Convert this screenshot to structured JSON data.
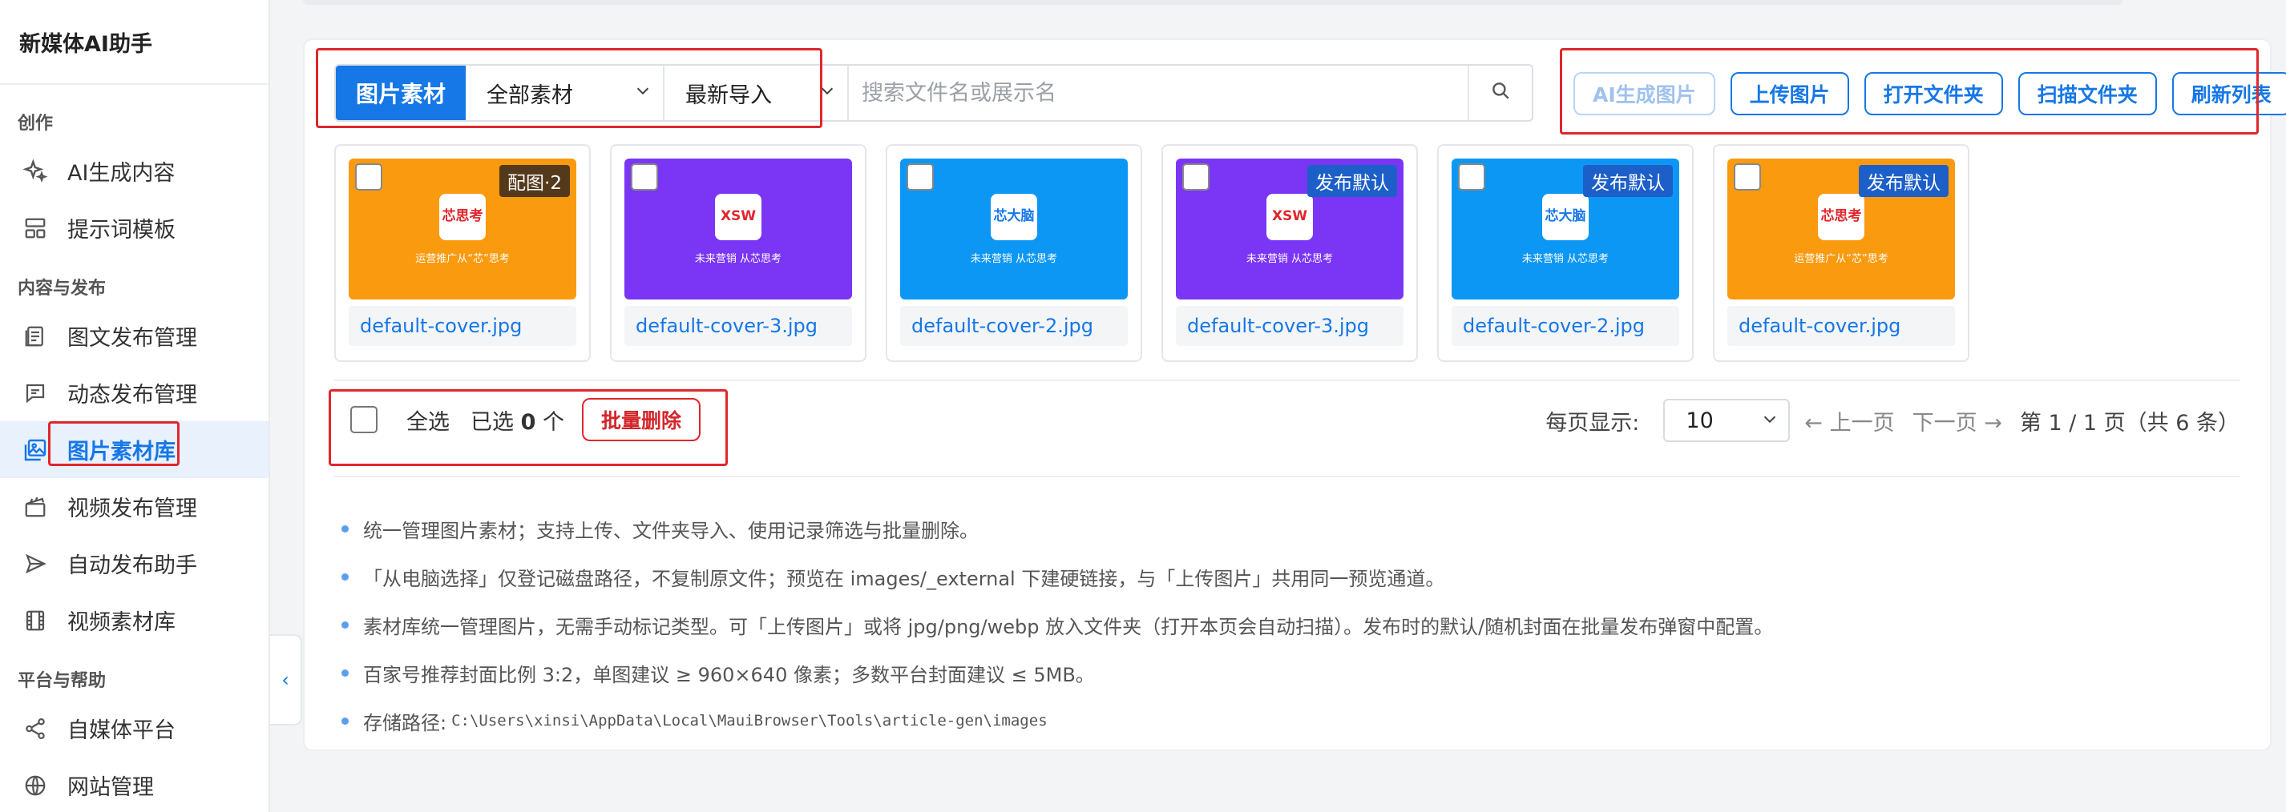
{
  "sidebar": {
    "brand": "新媒体AI助手",
    "sections": {
      "create": "创作",
      "content": "内容与发布",
      "platform": "平台与帮助"
    },
    "items": [
      {
        "label": "AI生成内容",
        "icon": "sparkle-icon"
      },
      {
        "label": "提示词模板",
        "icon": "template-icon"
      },
      {
        "label": "图文发布管理",
        "icon": "document-icon"
      },
      {
        "label": "动态发布管理",
        "icon": "message-icon"
      },
      {
        "label": "图片素材库",
        "icon": "image-library-icon"
      },
      {
        "label": "视频发布管理",
        "icon": "clapperboard-icon"
      },
      {
        "label": "自动发布助手",
        "icon": "send-icon"
      },
      {
        "label": "视频素材库",
        "icon": "film-icon"
      },
      {
        "label": "自媒体平台",
        "icon": "share-icon"
      },
      {
        "label": "网站管理",
        "icon": "globe-icon"
      }
    ],
    "active_item": "图片素材库"
  },
  "toolbar": {
    "filter_tab": "图片素材",
    "category_select": "全部素材",
    "sort_select": "最新导入",
    "search_placeholder": "搜索文件名或展示名",
    "actions": {
      "ai_generate": "AI生成图片",
      "upload": "上传图片",
      "open_folder": "打开文件夹",
      "scan_folder": "扫描文件夹",
      "refresh": "刷新列表"
    }
  },
  "thumbnails": [
    {
      "name": "default-cover.jpg",
      "badge": "配图·2",
      "bg": "#fa9a0f",
      "logo": "芯思考",
      "tagline": "运营推广从“芯”思考"
    },
    {
      "name": "default-cover-3.jpg",
      "badge": "",
      "bg": "#7a35f5",
      "logo": "XSW",
      "tagline": "未来营销 从芯思考"
    },
    {
      "name": "default-cover-2.jpg",
      "badge": "",
      "bg": "#0d97f5",
      "logo": "芯大脑",
      "tagline": "未来营销 从芯思考"
    },
    {
      "name": "default-cover-3.jpg",
      "badge": "发布默认",
      "bg": "#7a35f5",
      "logo": "XSW",
      "tagline": "未来营销 从芯思考"
    },
    {
      "name": "default-cover-2.jpg",
      "badge": "发布默认",
      "bg": "#0d97f5",
      "logo": "芯大脑",
      "tagline": "未来营销 从芯思考"
    },
    {
      "name": "default-cover.jpg",
      "badge": "发布默认",
      "bg": "#fa9a0f",
      "logo": "芯思考",
      "tagline": "运营推广从“芯”思考"
    }
  ],
  "bulk": {
    "select_all": "全选",
    "selected_prefix": "已选",
    "selected_count": "0",
    "selected_suffix": "个",
    "delete": "批量删除"
  },
  "pager": {
    "per_page_label": "每页显示:",
    "per_page_value": "10",
    "prev": "← 上一页",
    "next": "下一页 →",
    "status": "第 1 / 1 页（共 6 条）"
  },
  "notes": [
    "统一管理图片素材；支持上传、文件夹导入、使用记录筛选与批量删除。",
    "「从电脑选择」仅登记磁盘路径，不复制原文件；预览在 images/_external 下建硬链接，与「上传图片」共用同一预览通道。",
    "素材库统一管理图片，无需手动标记类型。可「上传图片」或将 jpg/png/webp 放入文件夹（打开本页会自动扫描）。发布时的默认/随机封面在批量发布弹窗中配置。",
    "百家号推荐封面比例 3:2，单图建议 ≥ 960×640 像素；多数平台封面建议 ≤ 5MB。"
  ],
  "storage": {
    "label": "存储路径:",
    "path": "C:\\Users\\xinsi\\AppData\\Local\\MauiBrowser\\Tools\\article-gen\\images"
  },
  "colors": {
    "accent": "#1677e6",
    "danger": "#e0272c"
  }
}
